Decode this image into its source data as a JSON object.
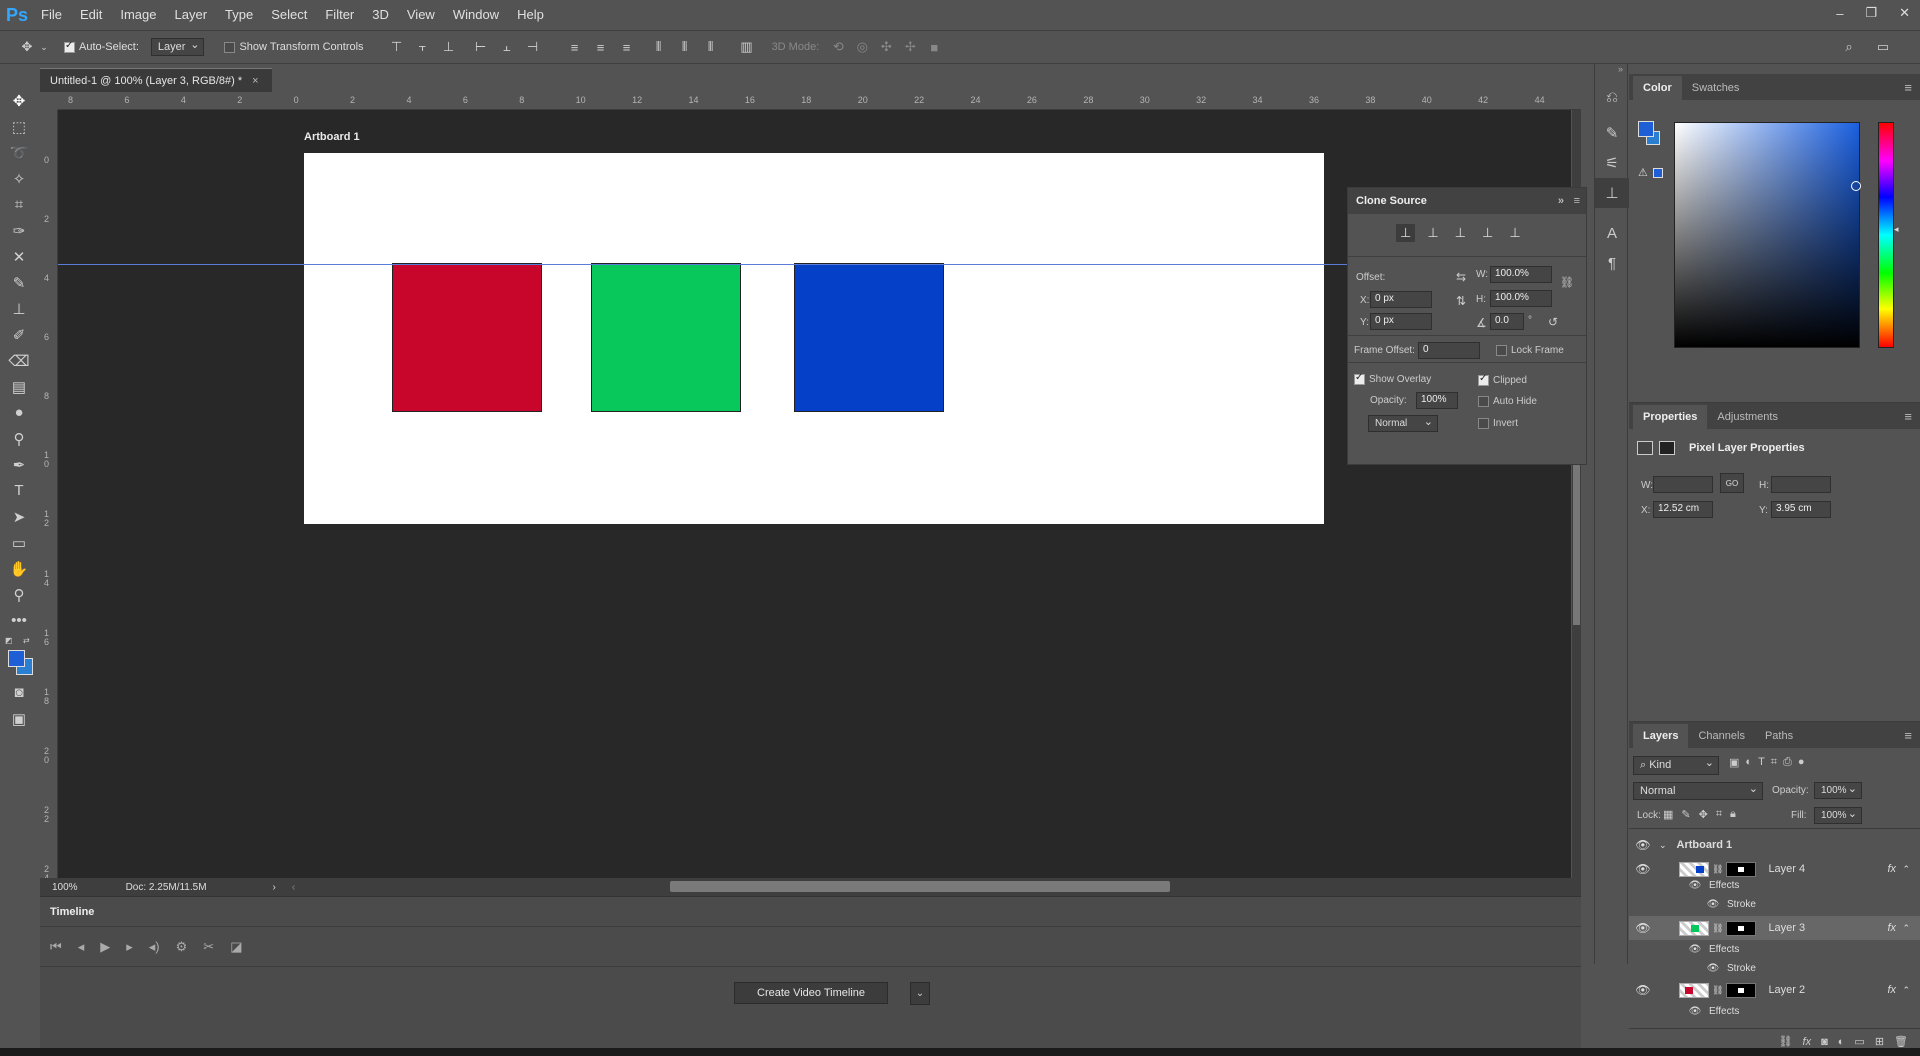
{
  "app": {
    "logo": "Ps"
  },
  "menu": [
    "File",
    "Edit",
    "Image",
    "Layer",
    "Type",
    "Select",
    "Filter",
    "3D",
    "View",
    "Window",
    "Help"
  ],
  "options": {
    "auto_select_label": "Auto-Select:",
    "auto_select_value": "Layer",
    "transform_label": "Show Transform Controls",
    "mode_3d": "3D Mode:"
  },
  "document": {
    "tab_title": "Untitled-1 @ 100% (Layer 3, RGB/8#) *",
    "close": "×",
    "artboard_label": "Artboard 1",
    "zoom": "100%",
    "doc_info": "Doc: 2.25M/11.5M",
    "ruler_top": [
      "8",
      "6",
      "4",
      "2",
      "0",
      "2",
      "4",
      "6",
      "8",
      "10",
      "12",
      "14",
      "16",
      "18",
      "20",
      "22",
      "24",
      "26",
      "28",
      "30",
      "32",
      "34",
      "36",
      "38",
      "40",
      "42",
      "44"
    ],
    "ruler_left": [
      "0",
      "2",
      "4",
      "6",
      "8",
      "1 0",
      "1 2",
      "1 4",
      "1 6",
      "1 8",
      "2 0",
      "2 2",
      "2 4"
    ],
    "squares": [
      {
        "name": "red",
        "color": "#c8062b"
      },
      {
        "name": "green",
        "color": "#08c75b"
      },
      {
        "name": "blue",
        "color": "#0540c9"
      }
    ]
  },
  "timeline": {
    "title": "Timeline",
    "create_button": "Create Video Timeline"
  },
  "clone_source": {
    "title": "Clone Source",
    "offset_label": "Offset:",
    "w_label": "W:",
    "w_value": "100.0%",
    "h_label": "H:",
    "h_value": "100.0%",
    "x_label": "X:",
    "x_value": "0 px",
    "y_label": "Y:",
    "y_value": "0 px",
    "angle_value": "0.0",
    "angle_unit": "°",
    "frame_offset_label": "Frame Offset:",
    "frame_offset_value": "0",
    "lock_frame": "Lock Frame",
    "show_overlay": "Show Overlay",
    "clipped": "Clipped",
    "opacity_label": "Opacity:",
    "opacity_value": "100%",
    "auto_hide": "Auto Hide",
    "blend_mode": "Normal",
    "invert": "Invert"
  },
  "color_panel": {
    "tabs": [
      "Color",
      "Swatches"
    ],
    "foreground": "#1f5fd6",
    "background": "#2a7fd0"
  },
  "properties": {
    "tabs": [
      "Properties",
      "Adjustments"
    ],
    "title": "Pixel Layer Properties",
    "w_label": "W:",
    "h_label": "H:",
    "link": "GO",
    "x_label": "X:",
    "x_value": "12.52 cm",
    "y_label": "Y:",
    "y_value": "3.95 cm"
  },
  "layers": {
    "tabs": [
      "Layers",
      "Channels",
      "Paths"
    ],
    "filter": "Kind",
    "blend": "Normal",
    "opacity_label": "Opacity:",
    "opacity_value": "100%",
    "lock_label": "Lock:",
    "fill_label": "Fill:",
    "fill_value": "100%",
    "artboard": "Artboard 1",
    "items": [
      {
        "name": "Layer 4",
        "effects": "Effects",
        "stroke": "Stroke",
        "fx": "fx"
      },
      {
        "name": "Layer 3",
        "effects": "Effects",
        "stroke": "Stroke",
        "fx": "fx"
      },
      {
        "name": "Layer 2",
        "effects": "Effects",
        "fx": "fx"
      }
    ]
  }
}
